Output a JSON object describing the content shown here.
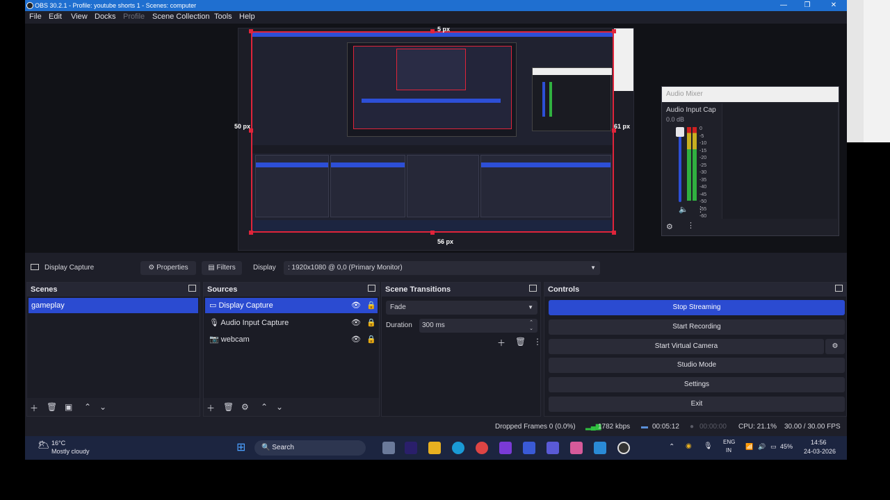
{
  "window": {
    "title": "OBS 30.2.1 - Profile: youtube shorts 1 - Scenes: computer",
    "minimize": "—",
    "restore": "❐",
    "close": "✕"
  },
  "menu": {
    "file": "File",
    "edit": "Edit",
    "view": "View",
    "docks": "Docks",
    "profile": "Profile",
    "scene_collection": "Scene Collection",
    "tools": "Tools",
    "help": "Help"
  },
  "preview": {
    "dim_top": "5 px",
    "dim_left": "50 px",
    "dim_right": "61 px",
    "dim_bottom": "56 px"
  },
  "audio_mixer": {
    "title": "Audio Mixer",
    "channel": "Audio Input Cap",
    "level": "0.0 dB",
    "ticks": [
      "0",
      "-5",
      "-10",
      "-15",
      "-20",
      "-25",
      "-30",
      "-35",
      "-40",
      "-45",
      "-50",
      "-55",
      "-60"
    ]
  },
  "source_toolbar": {
    "source_name": "Display Capture",
    "properties": "Properties",
    "filters": "Filters",
    "display_label": "Display",
    "display_value": ": 1920x1080 @ 0,0 (Primary Monitor)"
  },
  "scenes": {
    "title": "Scenes",
    "items": [
      "gameplay"
    ]
  },
  "sources": {
    "title": "Sources",
    "items": [
      "Display Capture",
      "Audio Input Capture",
      "webcam"
    ]
  },
  "transitions": {
    "title": "Scene Transitions",
    "type": "Fade",
    "duration_label": "Duration",
    "duration_value": "300 ms"
  },
  "controls": {
    "title": "Controls",
    "stop_streaming": "Stop Streaming",
    "start_recording": "Start Recording",
    "start_virtual_camera": "Start Virtual Camera",
    "studio_mode": "Studio Mode",
    "settings": "Settings",
    "exit": "Exit"
  },
  "status": {
    "dropped_frames": "Dropped Frames 0 (0.0%)",
    "bitrate": "1782 kbps",
    "stream_time": "00:05:12",
    "rec_time": "00:00:00",
    "cpu": "CPU: 21.1%",
    "fps": "30.00 / 30.00 FPS"
  },
  "taskbar": {
    "weather_temp": "16°C",
    "weather_text": "Mostly cloudy",
    "search": "Search",
    "lang_top": "ENG",
    "lang_bottom": "IN",
    "battery": "45%",
    "time": "14:56",
    "date": "24-03-2026"
  },
  "colors": {
    "accent": "#2b4bd1",
    "titlebar": "#1f6fd0",
    "capture_border": "#e0243a",
    "bg": "#1e1f29"
  }
}
